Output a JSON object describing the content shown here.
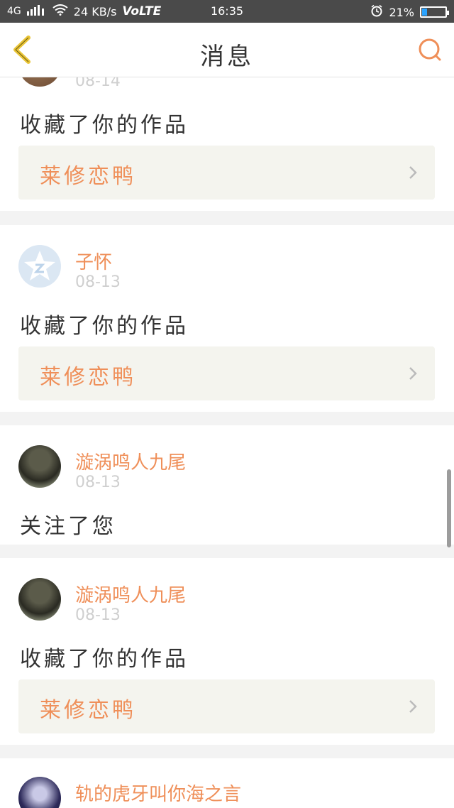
{
  "status": {
    "network": "4G",
    "speed": "24 KB/s",
    "volte": "VoLTE",
    "time": "16:35",
    "battery_text": "21%",
    "battery_level": 0.21
  },
  "header": {
    "title": "消息"
  },
  "messages": [
    {
      "name": "",
      "date": "08-14",
      "action": "收藏了你的作品",
      "work": "莱修恋鸭"
    },
    {
      "name": "子怀",
      "date": "08-13",
      "action": "收藏了你的作品",
      "work": "莱修恋鸭"
    },
    {
      "name": "漩涡鸣人九尾",
      "date": "08-13",
      "action": "关注了您"
    },
    {
      "name": "漩涡鸣人九尾",
      "date": "08-13",
      "action": "收藏了你的作品",
      "work": "莱修恋鸭"
    },
    {
      "name": "轨的虎牙叫你海之言",
      "date": "",
      "action": ""
    }
  ],
  "colors": {
    "accent": "#ef8f59",
    "back_arrow": "#e9c436",
    "status_bg": "#4a4a4a",
    "separator": "#f3f3f3"
  }
}
